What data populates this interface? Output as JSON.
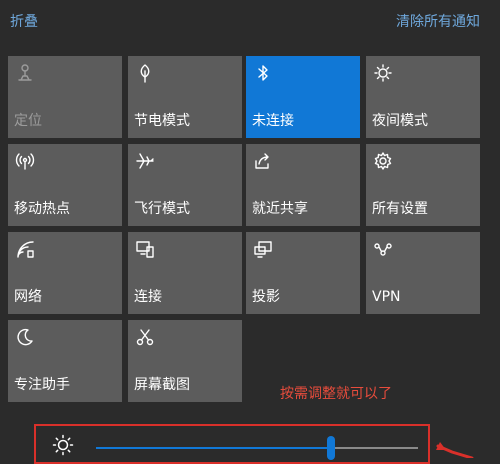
{
  "header": {
    "collapse_label": "折叠",
    "clear_all_label": "清除所有通知"
  },
  "tiles": [
    {
      "label": "定位",
      "icon": "location-icon",
      "state": "disabled"
    },
    {
      "label": "节电模式",
      "icon": "leaf-icon",
      "state": "normal"
    },
    {
      "label": "未连接",
      "icon": "bluetooth-icon",
      "state": "active"
    },
    {
      "label": "夜间模式",
      "icon": "night-light-icon",
      "state": "normal"
    },
    {
      "label": "移动热点",
      "icon": "hotspot-icon",
      "state": "normal"
    },
    {
      "label": "飞行模式",
      "icon": "airplane-icon",
      "state": "normal"
    },
    {
      "label": "就近共享",
      "icon": "share-icon",
      "state": "normal"
    },
    {
      "label": "所有设置",
      "icon": "gear-icon",
      "state": "normal"
    },
    {
      "label": "网络",
      "icon": "network-icon",
      "state": "normal"
    },
    {
      "label": "连接",
      "icon": "connect-icon",
      "state": "normal"
    },
    {
      "label": "投影",
      "icon": "project-icon",
      "state": "normal"
    },
    {
      "label": "VPN",
      "icon": "vpn-icon",
      "state": "normal"
    },
    {
      "label": "专注助手",
      "icon": "moon-icon",
      "state": "normal"
    },
    {
      "label": "屏幕截图",
      "icon": "screenshot-icon",
      "state": "normal"
    }
  ],
  "annotation": "按需调整就可以了",
  "brightness": {
    "icon": "brightness-icon",
    "level_percent": 73
  },
  "colors": {
    "accent": "#1178d6",
    "tile": "#5c5c5c",
    "background": "#2b2b2b",
    "link": "#6fa8dc",
    "annotation": "#e74c3c"
  }
}
